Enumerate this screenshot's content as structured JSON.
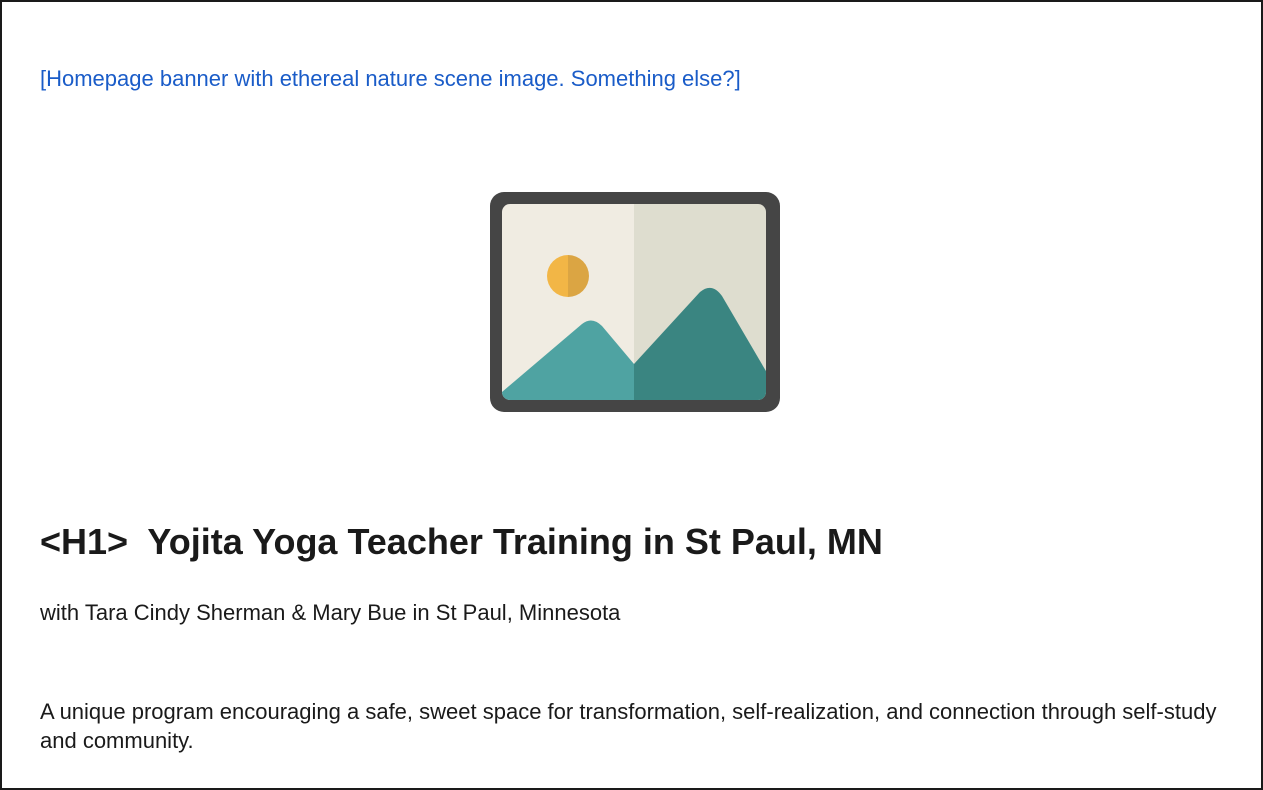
{
  "banner_note": "[Homepage banner with ethereal nature scene image. Something else?]",
  "image_placeholder": {
    "icon": "image-placeholder-icon",
    "colors": {
      "frame": "#454545",
      "sky_light": "#f0ece2",
      "sky_dark": "#deddcf",
      "sun_light": "#f2b646",
      "sun_dark": "#dba543",
      "mountain_light": "#4fa3a2",
      "mountain_dark": "#3a8581"
    }
  },
  "heading": "<H1>  Yojita Yoga Teacher Training in St Paul, MN",
  "subheading": "with Tara Cindy Sherman & Mary Bue in St Paul, Minnesota",
  "description": "A unique program encouraging a safe, sweet space for transformation, self-realization, and connection through self-study and community.",
  "colors": {
    "note_text": "#1a5cc8",
    "body_text": "#1a1a1a"
  }
}
